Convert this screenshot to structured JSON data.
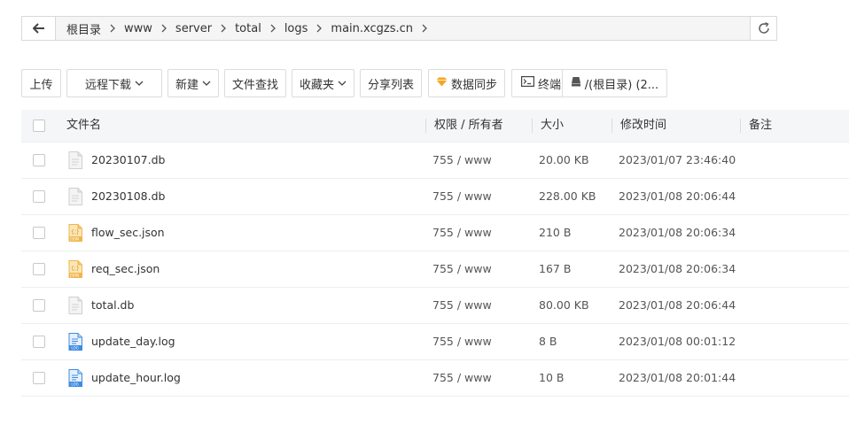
{
  "breadcrumb": {
    "items": [
      "根目录",
      "www",
      "server",
      "total",
      "logs",
      "main.xcgzs.cn"
    ]
  },
  "toolbar": {
    "upload": "上传",
    "remote_download": "远程下载",
    "new": "新建",
    "file_search": "文件查找",
    "favorites": "收藏夹",
    "share_list": "分享列表",
    "data_sync": "数据同步",
    "terminal": "终端",
    "disk": "/(根目录) (2..."
  },
  "table": {
    "headers": {
      "name": "文件名",
      "permission": "权限 / 所有者",
      "size": "大小",
      "mtime": "修改时间",
      "note": "备注"
    },
    "rows": [
      {
        "name": "20230107.db",
        "type": "db",
        "perm": "755 / www",
        "size": "20.00 KB",
        "mtime": "2023/01/07 23:46:40",
        "note": ""
      },
      {
        "name": "20230108.db",
        "type": "db",
        "perm": "755 / www",
        "size": "228.00 KB",
        "mtime": "2023/01/08 20:06:44",
        "note": ""
      },
      {
        "name": "flow_sec.json",
        "type": "json",
        "perm": "755 / www",
        "size": "210 B",
        "mtime": "2023/01/08 20:06:34",
        "note": ""
      },
      {
        "name": "req_sec.json",
        "type": "json",
        "perm": "755 / www",
        "size": "167 B",
        "mtime": "2023/01/08 20:06:34",
        "note": ""
      },
      {
        "name": "total.db",
        "type": "db",
        "perm": "755 / www",
        "size": "80.00 KB",
        "mtime": "2023/01/08 20:06:44",
        "note": ""
      },
      {
        "name": "update_day.log",
        "type": "log",
        "perm": "755 / www",
        "size": "8 B",
        "mtime": "2023/01/08 00:01:12",
        "note": ""
      },
      {
        "name": "update_hour.log",
        "type": "log",
        "perm": "755 / www",
        "size": "10 B",
        "mtime": "2023/01/08 20:01:44",
        "note": ""
      }
    ]
  },
  "icons": {
    "db": "generic-file-icon",
    "json": "json-file-icon",
    "log": "log-file-icon"
  },
  "colors": {
    "header_bg": "#f5f6f7",
    "json_icon": "#f0b64c",
    "log_icon": "#3f8be2",
    "sync_icon": "#f5a623"
  }
}
